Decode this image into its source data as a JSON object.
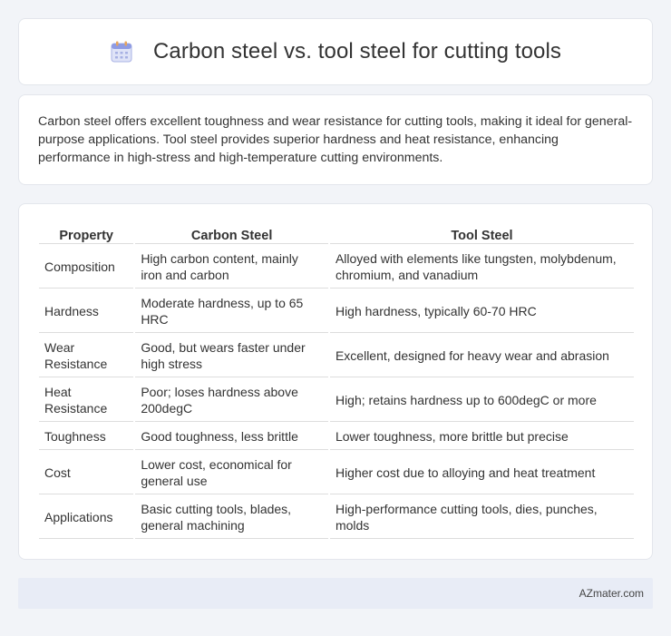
{
  "header": {
    "title": "Carbon steel vs. tool steel for cutting tools",
    "icon": "calendar-icon"
  },
  "summary": {
    "text": "Carbon steel offers excellent toughness and wear resistance for cutting tools, making it ideal for general-purpose applications. Tool steel provides superior hardness and heat resistance, enhancing performance in high-stress and high-temperature cutting environments."
  },
  "table": {
    "headers": [
      "Property",
      "Carbon Steel",
      "Tool Steel"
    ],
    "rows": [
      [
        "Composition",
        "High carbon content, mainly iron and carbon",
        "Alloyed with elements like tungsten, molybdenum, chromium, and vanadium"
      ],
      [
        "Hardness",
        "Moderate hardness, up to 65 HRC",
        "High hardness, typically 60-70 HRC"
      ],
      [
        "Wear Resistance",
        "Good, but wears faster under high stress",
        "Excellent, designed for heavy wear and abrasion"
      ],
      [
        "Heat Resistance",
        "Poor; loses hardness above 200degC",
        "High; retains hardness up to 600degC or more"
      ],
      [
        "Toughness",
        "Good toughness, less brittle",
        "Lower toughness, more brittle but precise"
      ],
      [
        "Cost",
        "Lower cost, economical for general use",
        "Higher cost due to alloying and heat treatment"
      ],
      [
        "Applications",
        "Basic cutting tools, blades, general machining",
        "High-performance cutting tools, dies, punches, molds"
      ]
    ]
  },
  "footer": {
    "text": "AZmater.com"
  },
  "colors": {
    "background": "#f2f4f8",
    "card": "#ffffff",
    "footer": "#e8ecf6",
    "text": "#333333"
  }
}
